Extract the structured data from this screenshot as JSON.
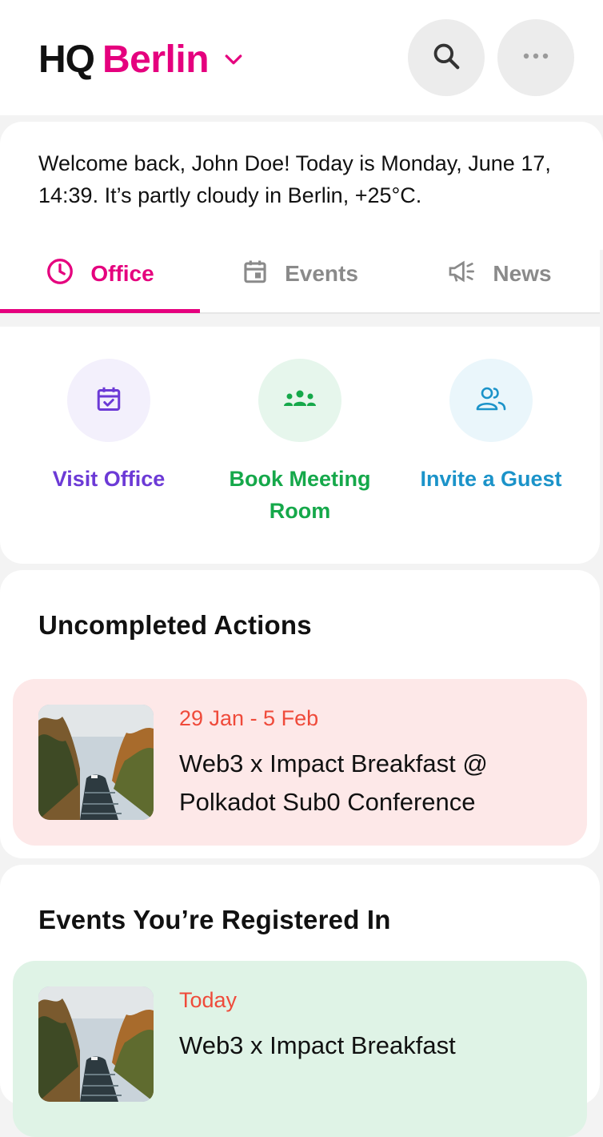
{
  "header": {
    "brand_prefix": "HQ",
    "brand_city": "Berlin",
    "icons": {
      "city_dropdown": "chevron-down-icon",
      "search": "search-icon",
      "more": "more-horizontal-icon"
    }
  },
  "welcome": {
    "text": "Welcome back, John Doe! Today is Monday, June 17, 14:39. It’s partly cloudy in Berlin, +25°C."
  },
  "tabs": [
    {
      "label": "Office",
      "icon": "clock-icon",
      "active": true
    },
    {
      "label": "Events",
      "icon": "calendar-icon",
      "active": false
    },
    {
      "label": "News",
      "icon": "megaphone-icon",
      "active": false
    }
  ],
  "quick_actions": [
    {
      "label": "Visit Office",
      "icon": "calendar-check-icon",
      "color": "#6c3ad6"
    },
    {
      "label": "Book Meeting Room",
      "icon": "group-icon",
      "color": "#15a84a"
    },
    {
      "label": "Invite a Guest",
      "icon": "users-icon",
      "color": "#1b93c9"
    }
  ],
  "uncompleted": {
    "title": "Uncompleted Actions",
    "event": {
      "date": "29 Jan - 5 Feb",
      "title": "Web3 x Impact Breakfast @ Polkadot Sub0 Conference"
    }
  },
  "registered": {
    "title": "Events You’re Registered In",
    "event": {
      "date": "Today",
      "title": "Web3 x Impact Breakfast"
    }
  },
  "colors": {
    "brand": "#e5007e",
    "date_text": "#ef4a3a",
    "pink_card": "#fde8e8",
    "green_card": "#dff3e6"
  }
}
